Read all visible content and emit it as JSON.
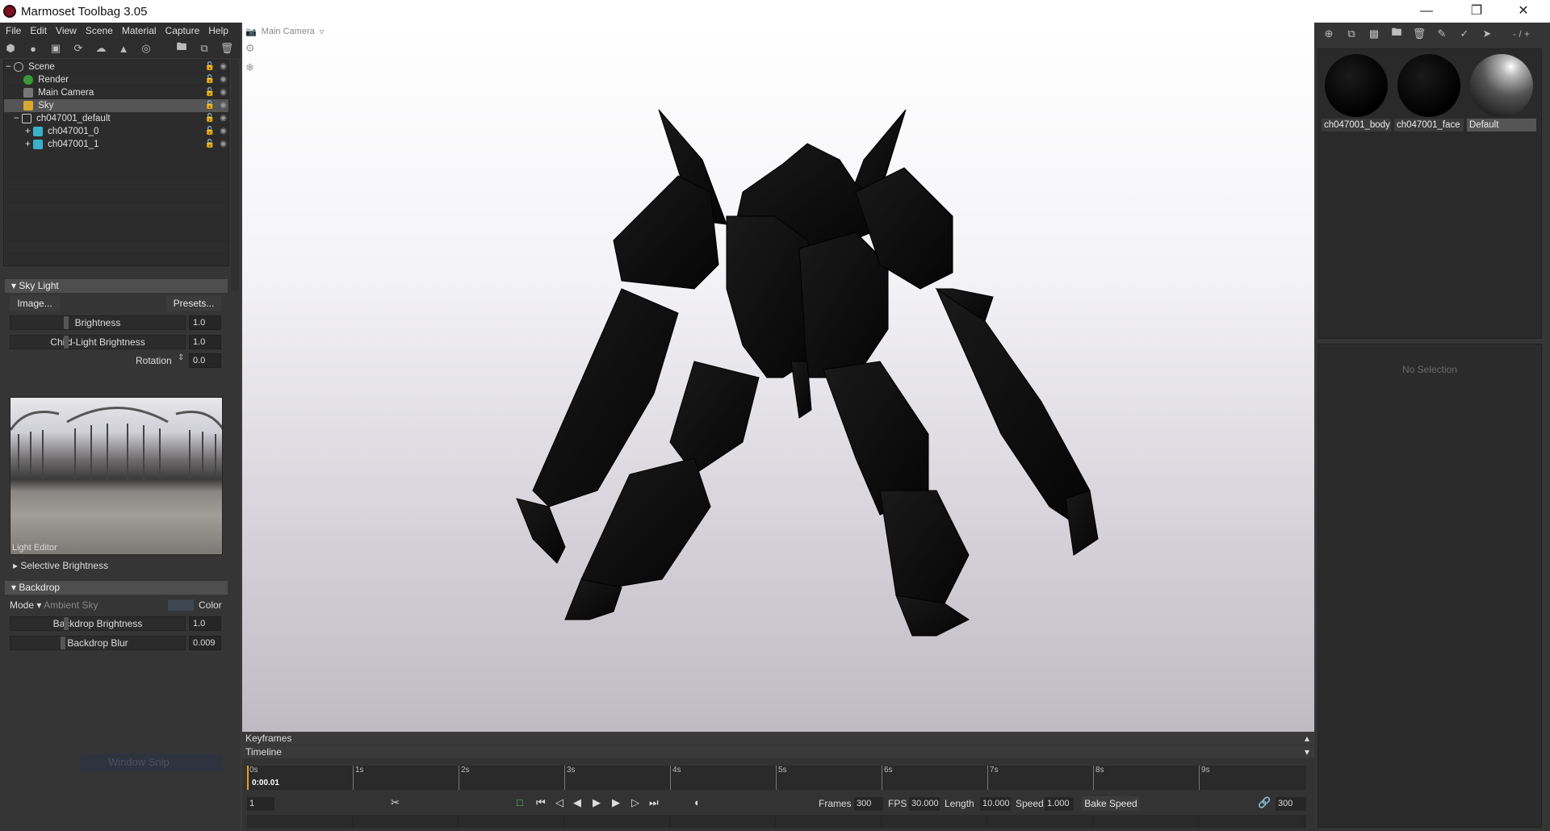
{
  "window": {
    "title": "Marmoset Toolbag 3.05"
  },
  "menu": [
    "File",
    "Edit",
    "View",
    "Scene",
    "Material",
    "Capture",
    "Help"
  ],
  "outliner": {
    "rows": [
      {
        "label": "Scene",
        "indent": 0,
        "icon": "scene-icon",
        "expander": "−"
      },
      {
        "label": "Render",
        "indent": 1,
        "icon": "render-icon",
        "expander": ""
      },
      {
        "label": "Main Camera",
        "indent": 1,
        "icon": "camera-icon",
        "expander": ""
      },
      {
        "label": "Sky",
        "indent": 1,
        "icon": "sky-icon",
        "expander": "",
        "selected": true
      },
      {
        "label": "ch047001_default",
        "indent": 1,
        "icon": "object-icon",
        "expander": "−"
      },
      {
        "label": "ch047001_0",
        "indent": 2,
        "icon": "mesh-icon",
        "expander": "+"
      },
      {
        "label": "ch047001_1",
        "indent": 2,
        "icon": "mesh-icon",
        "expander": "+"
      }
    ]
  },
  "skylight": {
    "header": "Sky Light",
    "image_btn": "Image...",
    "presets_btn": "Presets...",
    "brightness_label": "Brightness",
    "brightness": "1.0",
    "child_label": "Child-Light Brightness",
    "child": "1.0",
    "rotation_label": "Rotation",
    "rotation": "0.0",
    "light_editor": "Light Editor",
    "selective": "Selective Brightness"
  },
  "backdrop": {
    "header": "Backdrop",
    "mode_label": "Mode",
    "mode_value": "Ambient Sky",
    "color_label": "Color",
    "brightness_label": "Backdrop Brightness",
    "brightness": "1.0",
    "blur_label": "Backdrop Blur",
    "blur": "0.009"
  },
  "window_snip": "Window Snip",
  "viewport": {
    "camera": "Main Camera"
  },
  "timeline": {
    "keyframes": "Keyframes",
    "timeline": "Timeline",
    "time": "0:00.01",
    "ticks": [
      "0s",
      "1s",
      "2s",
      "3s",
      "4s",
      "5s",
      "6s",
      "7s",
      "8s",
      "9s"
    ],
    "frame": "1",
    "frames_label": "Frames",
    "frames": "300",
    "fps_label": "FPS",
    "fps": "30.000",
    "length_label": "Length",
    "length": "10.000",
    "speed_label": "Speed",
    "speed": "1.000",
    "bake": "Bake Speed",
    "end_frame": "300"
  },
  "materials": {
    "items": [
      {
        "name": "ch047001_body"
      },
      {
        "name": "ch047001_face"
      },
      {
        "name": "Default"
      }
    ],
    "zoom": "- / +",
    "no_selection": "No Selection"
  }
}
